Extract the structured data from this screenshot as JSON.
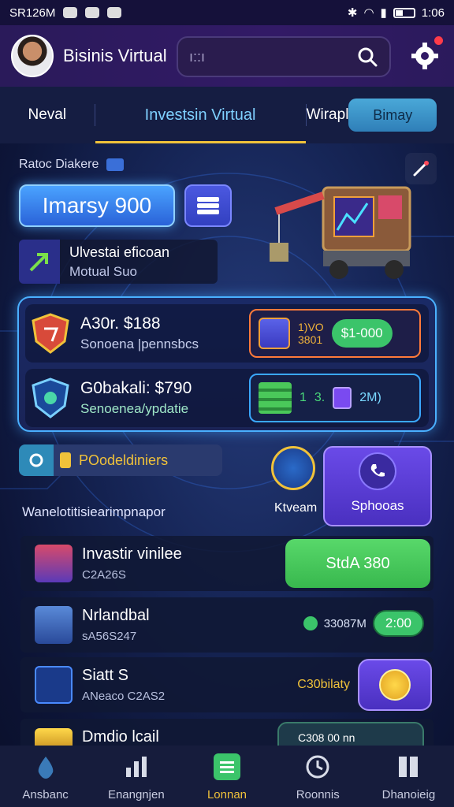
{
  "status_bar": {
    "time_left": "SR126M",
    "time_right": "1:06"
  },
  "header": {
    "app_title": "Bisinis Virtual",
    "search_placeholder": "ı::ı"
  },
  "tabs": [
    {
      "label": "Neval"
    },
    {
      "label": "Investsin Virtual"
    },
    {
      "label": "Wirapl"
    },
    {
      "label": "Bimay"
    }
  ],
  "hero": {
    "section_label": "Ratoc Diakere",
    "main_pill": "Imarsy 900",
    "info_line1": "Ulvestai eficoan",
    "info_line2": "Motual Suo"
  },
  "panel": {
    "row1": {
      "title": "A30r. $188",
      "subtitle": "Sonoena |pennsbcs",
      "stack_line1": "1)VO",
      "stack_line2": "3801",
      "pill": "$1-000"
    },
    "row2": {
      "title": "G0bakali: $790",
      "subtitle": "Senoenea/ypdatie",
      "num1": "1",
      "num2": "3.",
      "value": "2M)"
    }
  },
  "actions": {
    "promo_label": "POodeldiniers",
    "round_label": "Ktveam",
    "support_label": "Sphooas"
  },
  "list": {
    "title": "Wanelotitisiearimpnapor",
    "items": [
      {
        "name": "Invastir vinilee",
        "sub": "C2A26S",
        "cta": "StdA 380"
      },
      {
        "name": "Nrlandbal",
        "sub": "sA56S247",
        "value": "33087M",
        "pill": "2:00"
      },
      {
        "name": "Siatt S",
        "sub": "ANeaco C2AS2",
        "value": "C30bilaty"
      },
      {
        "name": "Dmdio lcail",
        "value": "C308 00 nn"
      }
    ]
  },
  "bottom_nav": [
    {
      "label": "Ansbanc",
      "icon": "drop-icon"
    },
    {
      "label": "Enangnjen",
      "icon": "chart-icon"
    },
    {
      "label": "Lonnan",
      "icon": "list-icon"
    },
    {
      "label": "Roonnis",
      "icon": "clock-icon"
    },
    {
      "label": "Dhanoieig",
      "icon": "panel-icon"
    }
  ],
  "colors": {
    "accent_green": "#3bc46a",
    "accent_gold": "#f0c23a",
    "accent_blue": "#4ab0ff",
    "accent_purple": "#6a4ae8"
  }
}
